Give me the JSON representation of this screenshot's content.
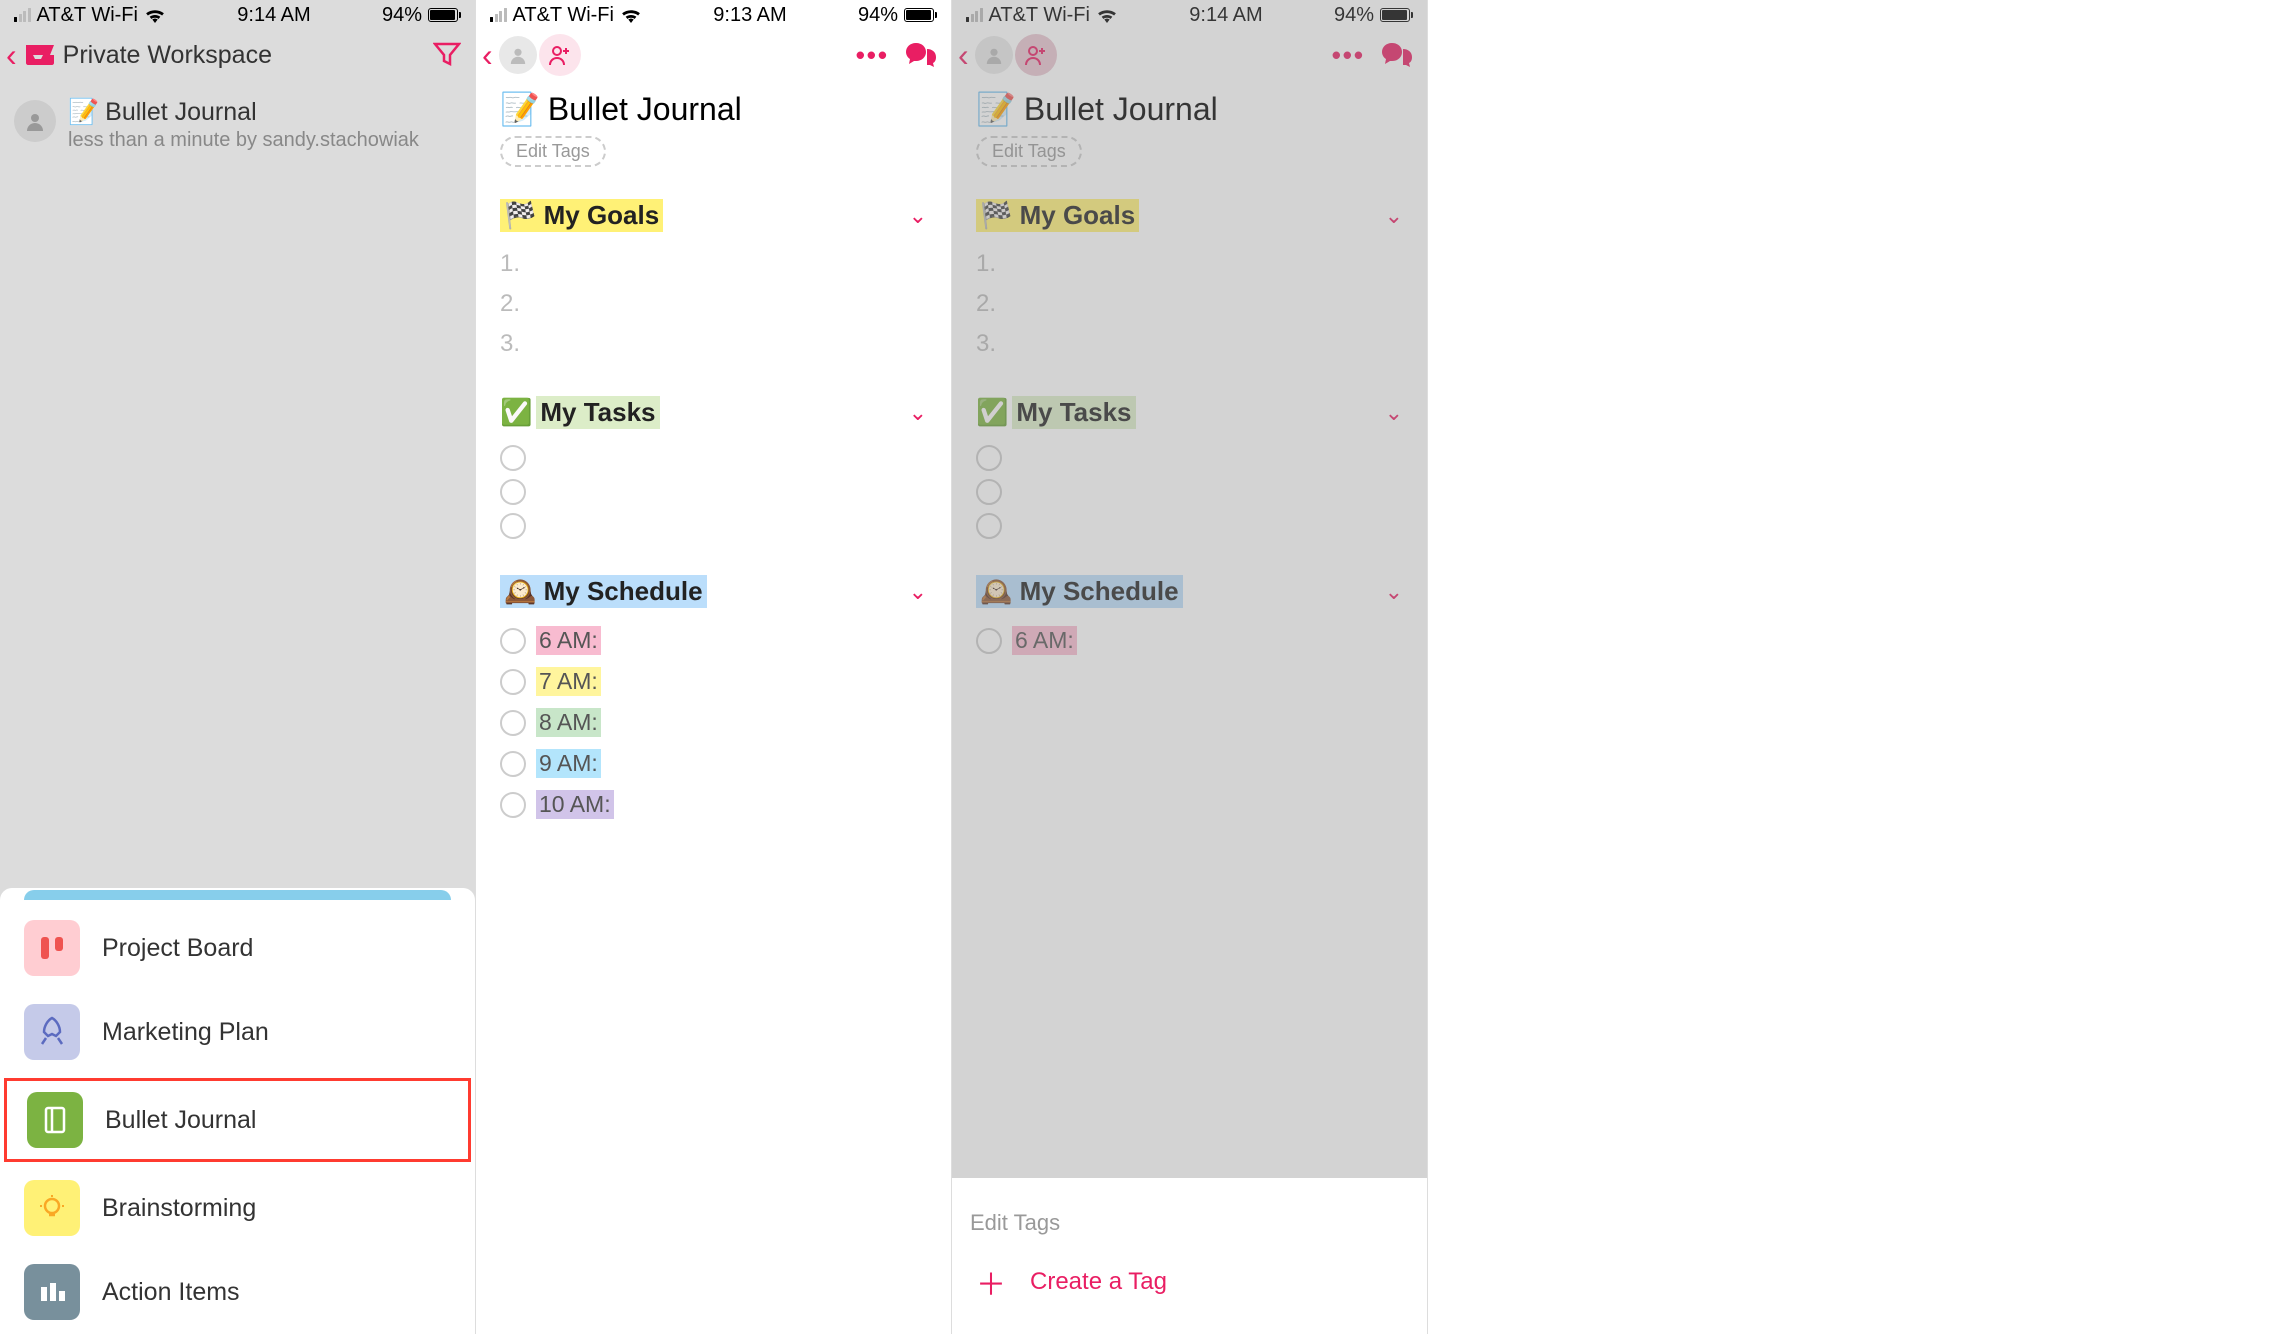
{
  "status": {
    "carrier": "AT&T Wi-Fi",
    "time1": "9:14 AM",
    "time2": "9:13 AM",
    "time3": "9:14 AM",
    "battery": "94%"
  },
  "screen1": {
    "workspace": "Private Workspace",
    "item_title": "Bullet Journal",
    "item_subtitle": "less than a minute by sandy.stachowiak",
    "templates": [
      {
        "label": "Project Board",
        "icon": "project-board-icon",
        "bg": "#ffcdd2",
        "fg": "#e57373"
      },
      {
        "label": "Marketing Plan",
        "icon": "rocket-icon",
        "bg": "#c5cae9",
        "fg": "#5c6bc0"
      },
      {
        "label": "Bullet Journal",
        "icon": "journal-icon",
        "bg": "#7cb342",
        "fg": "#fff"
      },
      {
        "label": "Brainstorming",
        "icon": "lightbulb-icon",
        "bg": "#fff176",
        "fg": "#fbc02d"
      },
      {
        "label": "Action Items",
        "icon": "action-items-icon",
        "bg": "#78909c",
        "fg": "#fff"
      }
    ]
  },
  "doc": {
    "title": "Bullet Journal",
    "edit_tags": "Edit Tags",
    "sections": {
      "goals": {
        "title": "My Goals",
        "items": [
          "1.",
          "2.",
          "3."
        ]
      },
      "tasks": {
        "title": "My Tasks"
      },
      "schedule": {
        "title": "My Schedule",
        "times": [
          "6 AM:",
          "7 AM:",
          "8 AM:",
          "9 AM:",
          "10 AM:"
        ]
      }
    }
  },
  "tag_sheet": {
    "title": "Edit Tags",
    "create": "Create a Tag"
  },
  "icons": {
    "person": "person-icon",
    "add_person": "add-person-icon",
    "notepad_emoji": "📝",
    "flag_emoji": "🏁",
    "check_emoji": "✅",
    "clock_emoji": "🕰️"
  }
}
